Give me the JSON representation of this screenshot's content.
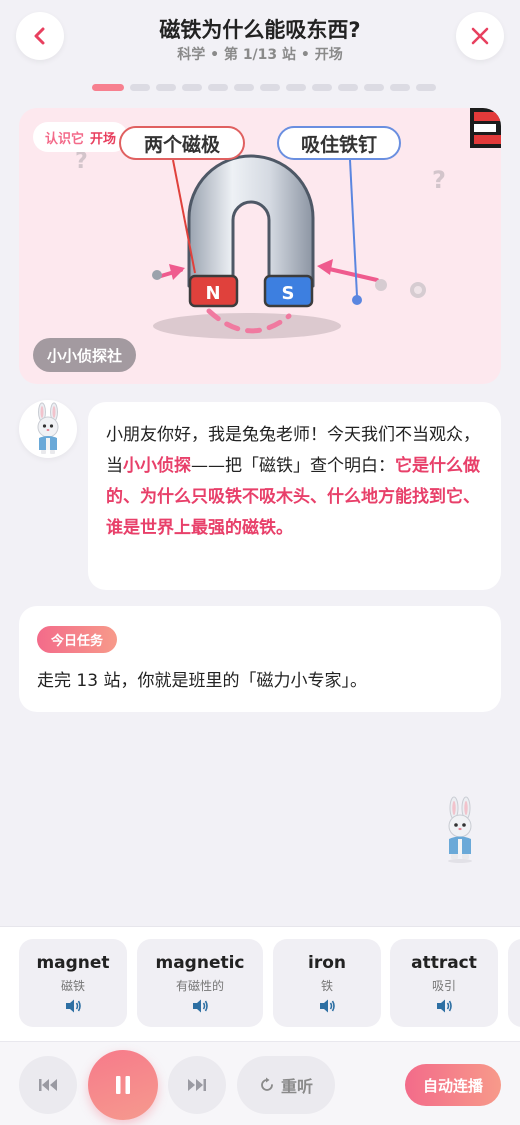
{
  "header": {
    "title": "磁铁为什么能吸东西?",
    "subtitle": "科学 • 第 1/13 站 • 开场",
    "back_icon": "chevron-left-icon",
    "close_icon": "close-icon",
    "progress": {
      "total": 13,
      "current": 1
    }
  },
  "hero": {
    "tag": "认识它",
    "stage": "开场",
    "label_poles": "两个磁极",
    "label_nail": "吸住铁钉",
    "pole_n": "N",
    "pole_s": "S",
    "question_mark": "?",
    "club_badge": "小小侦探社"
  },
  "speech": {
    "part1": "小朋友你好，我是兔兔老师！今天我们不当观众，当",
    "role": "小小侦探",
    "part2": "——把「磁铁」查个明白：",
    "questions": "它是什么做的、为什么只吸铁不吸木头、什么地方能找到它、谁是世界上最强的磁铁。"
  },
  "task": {
    "badge": "今日任务",
    "text": "走完 13 站，你就是班里的「磁力小专家」。"
  },
  "vocab": [
    {
      "word": "magnet",
      "meaning": "磁铁",
      "icon": "speaker-icon"
    },
    {
      "word": "magnetic",
      "meaning": "有磁性的",
      "icon": "speaker-icon"
    },
    {
      "word": "iron",
      "meaning": "铁",
      "icon": "speaker-icon"
    },
    {
      "word": "attract",
      "meaning": "吸引",
      "icon": "speaker-icon"
    }
  ],
  "controls": {
    "replay": "重听",
    "auto": "自动连播",
    "icons": [
      "previous-icon",
      "pause-icon",
      "next-icon",
      "replay-icon"
    ]
  },
  "colors": {
    "accent": "#f36b8a",
    "highlight": "#e8406a",
    "pole_n": "#e0413c",
    "pole_s": "#3d7fe0",
    "background": "#f2f1f6"
  }
}
